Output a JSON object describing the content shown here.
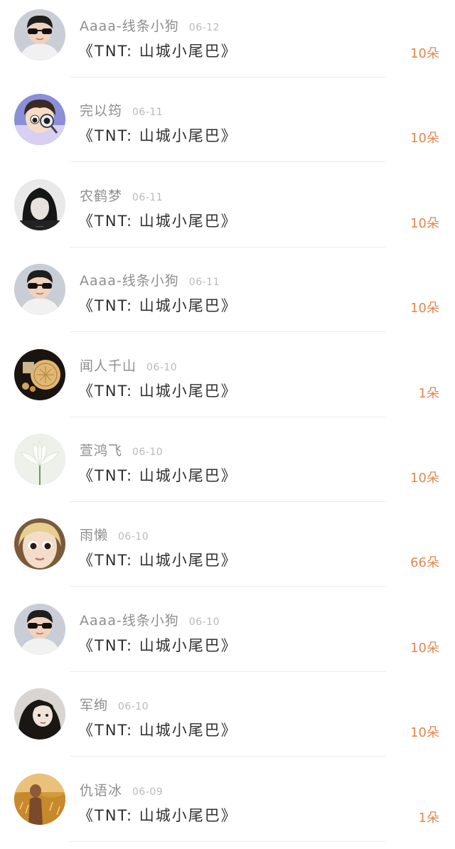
{
  "gift_records": [
    {
      "avatar": "sunglasses-boy-avatar",
      "username": "Aaaa-线条小狗",
      "date": "06-12",
      "title": "《TNT: 山城小尾巴》",
      "amount": "10朵"
    },
    {
      "avatar": "cartoon-girl-magnifier-avatar",
      "username": "完以筠",
      "date": "06-11",
      "title": "《TNT: 山城小尾巴》",
      "amount": "10朵"
    },
    {
      "avatar": "black-hair-girl-avatar",
      "username": "农鹤梦",
      "date": "06-11",
      "title": "《TNT: 山城小尾巴》",
      "amount": "10朵"
    },
    {
      "avatar": "sunglasses-boy-avatar",
      "username": "Aaaa-线条小狗",
      "date": "06-11",
      "title": "《TNT: 山城小尾巴》",
      "amount": "10朵"
    },
    {
      "avatar": "mooncake-avatar",
      "username": "闻人千山",
      "date": "06-10",
      "title": "《TNT: 山城小尾巴》",
      "amount": "1朵"
    },
    {
      "avatar": "white-lotus-avatar",
      "username": "萱鸿飞",
      "date": "06-10",
      "title": "《TNT: 山城小尾巴》",
      "amount": "10朵"
    },
    {
      "avatar": "doll-face-avatar",
      "username": "雨懒",
      "date": "06-10",
      "title": "《TNT: 山城小尾巴》",
      "amount": "66朵"
    },
    {
      "avatar": "sunglasses-boy-avatar",
      "username": "Aaaa-线条小狗",
      "date": "06-10",
      "title": "《TNT: 山城小尾巴》",
      "amount": "10朵"
    },
    {
      "avatar": "dark-hair-woman-avatar",
      "username": "军绚",
      "date": "06-10",
      "title": "《TNT: 山城小尾巴》",
      "amount": "10朵"
    },
    {
      "avatar": "golden-field-avatar",
      "username": "仇语冰",
      "date": "06-09",
      "title": "《TNT: 山城小尾巴》",
      "amount": "1朵"
    }
  ],
  "colors": {
    "amount": "#e3874f",
    "username": "#8e8e8e",
    "date": "#b9b9b9",
    "title": "#2f2f2f",
    "divider": "#ececec"
  }
}
